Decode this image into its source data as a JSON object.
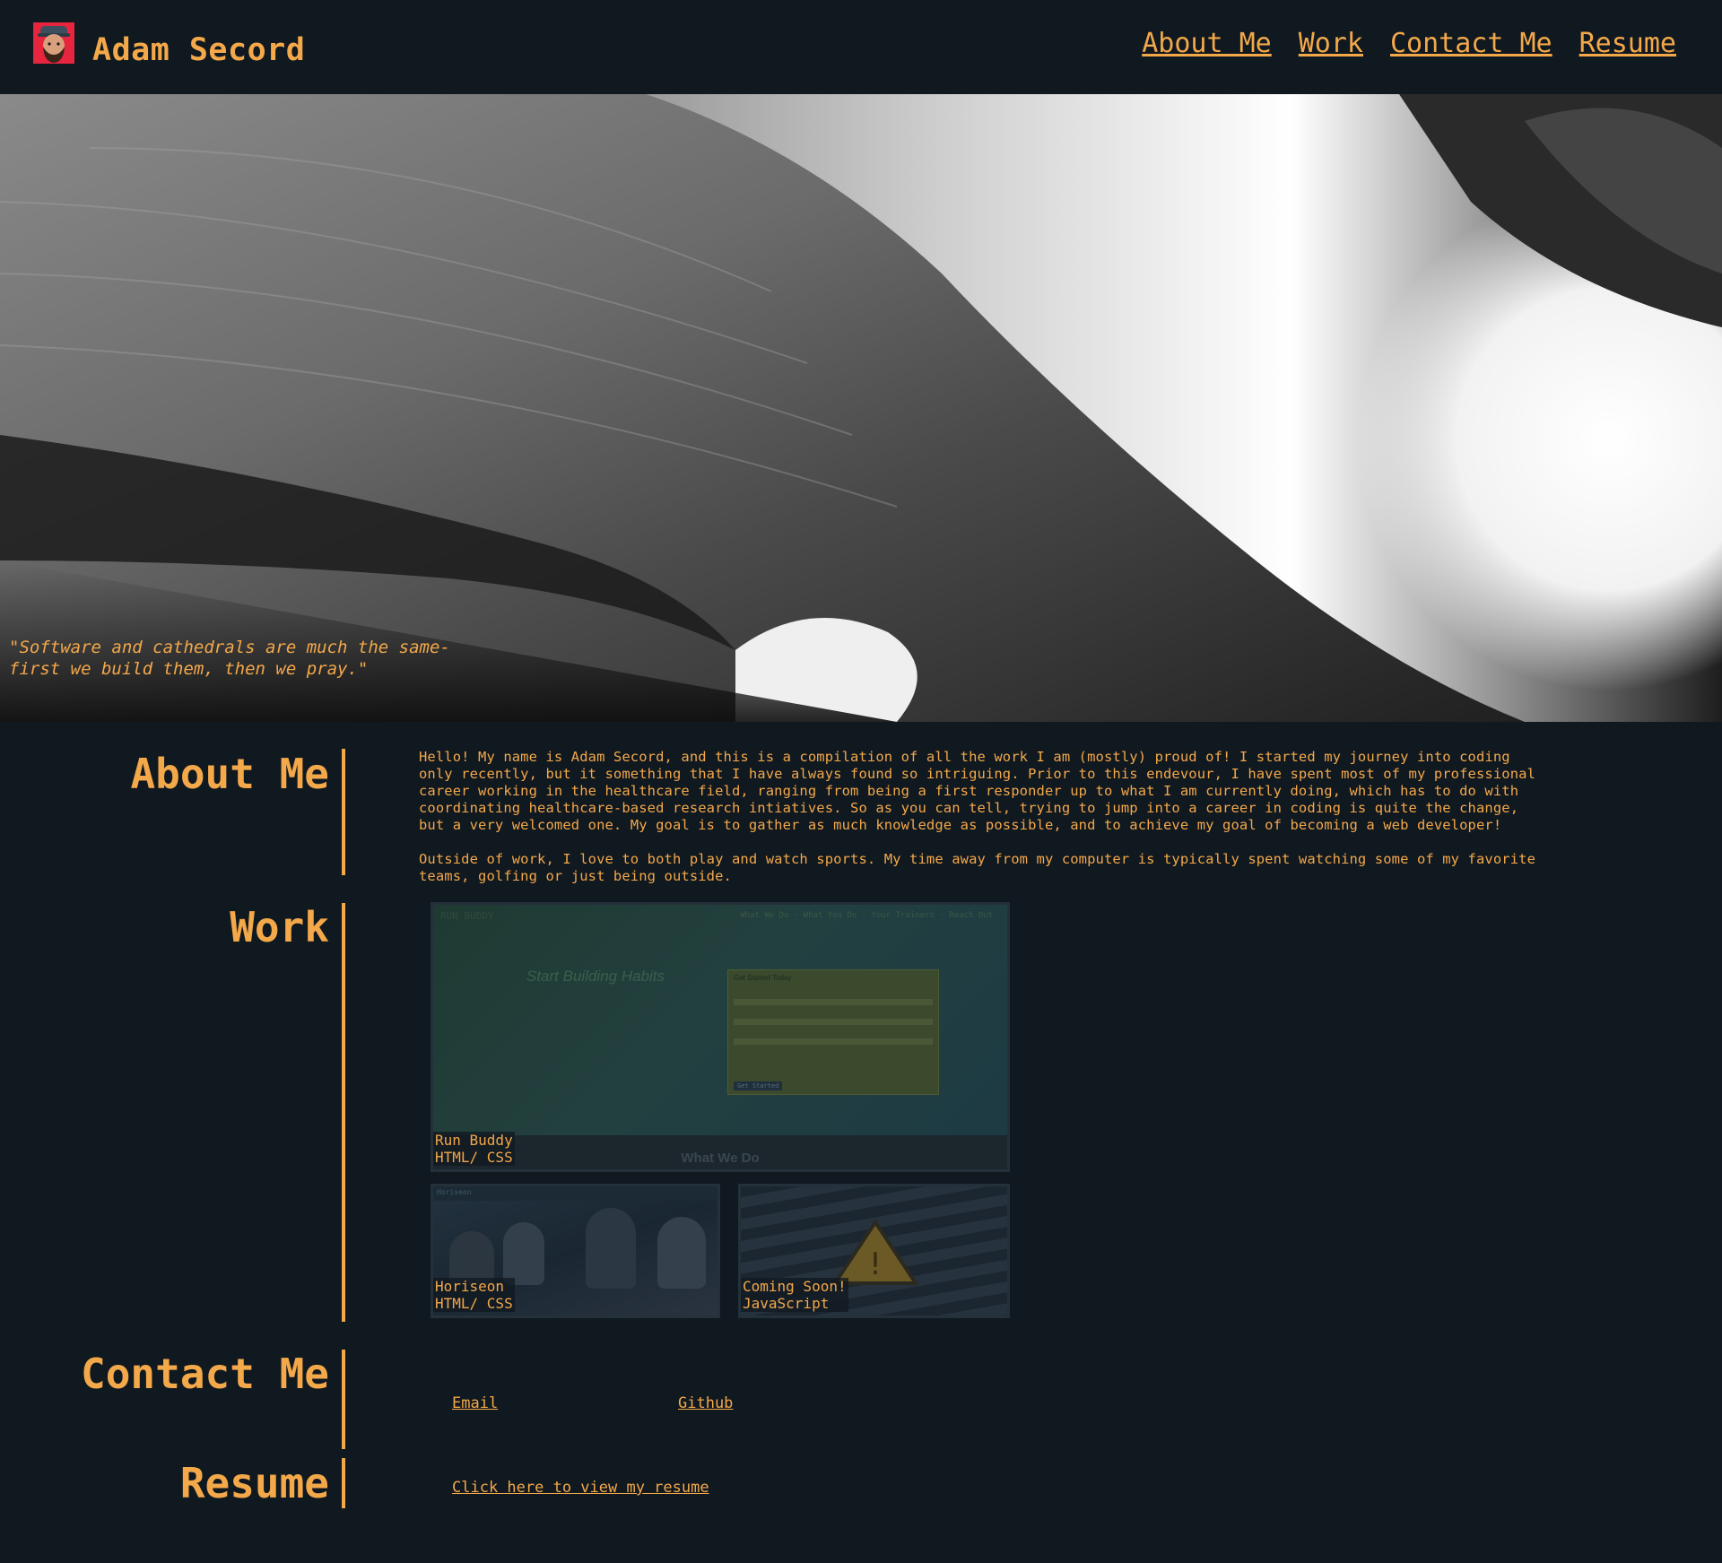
{
  "header": {
    "name": "Adam Secord",
    "nav": [
      "About Me",
      "Work",
      "Contact Me",
      "Resume"
    ]
  },
  "hero": {
    "quote": "\"Software and cathedrals are much the same-\nfirst we build them, then we pray.\""
  },
  "about": {
    "title": "About Me",
    "paragraph1": "Hello! My name is Adam Secord, and this is a compilation of all the work I am (mostly) proud of! I started my journey into coding only recently, but it something that I have always found so intriguing. Prior to this endevour, I have spent most of my professional career working in the healthcare field, ranging from being a first responder up to what I am currently doing, which has to do with coordinating healthcare-based research intiatives. So as you can tell, trying to jump into a career in coding is quite the change, but a very welcomed one. My goal is to gather as much knowledge as possible, and to achieve my goal of becoming a web developer!",
    "paragraph2": "Outside of work, I love to both play and watch sports. My time away from my computer is typically spent watching some of my favorite teams, golfing or just being outside."
  },
  "work": {
    "title": "Work",
    "projects": [
      {
        "name": "Run Buddy",
        "tech": "HTML/ CSS",
        "thumb_brand": "RUN BUDDY",
        "thumb_nav": "What We Do · What You Do · Your Trainers · Reach Out",
        "thumb_heading": "Start Building Habits",
        "thumb_form_title": "Get Started Today",
        "thumb_button": "Get Started",
        "thumb_footer": "What We Do"
      },
      {
        "name": "Horiseon",
        "tech": "HTML/ CSS",
        "thumb_brand": "Horiseon"
      },
      {
        "name": "Coming Soon!",
        "tech": "JavaScript"
      }
    ]
  },
  "contact": {
    "title": "Contact Me",
    "email": "Email",
    "github": "Github"
  },
  "resume": {
    "title": "Resume",
    "link": "Click here to view my resume"
  },
  "colors": {
    "background": "#101820",
    "accent": "#f3a84a",
    "avatar_bg": "#e8253f"
  }
}
